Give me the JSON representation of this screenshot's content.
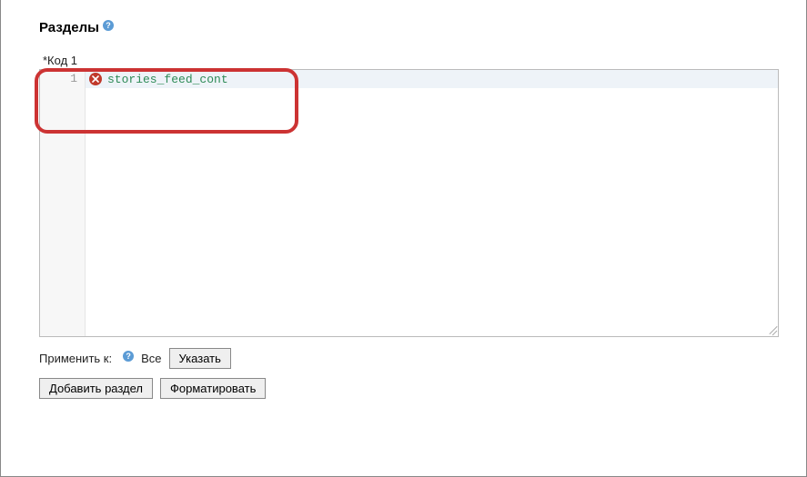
{
  "header": {
    "title": "Разделы"
  },
  "codeSection": {
    "label": "*Код 1",
    "lineNumber": "1",
    "code": "stories_feed_cont"
  },
  "applyRow": {
    "label": "Применить к:",
    "value": "Все",
    "specifyButton": "Указать"
  },
  "buttons": {
    "addSection": "Добавить раздел",
    "format": "Форматировать"
  }
}
